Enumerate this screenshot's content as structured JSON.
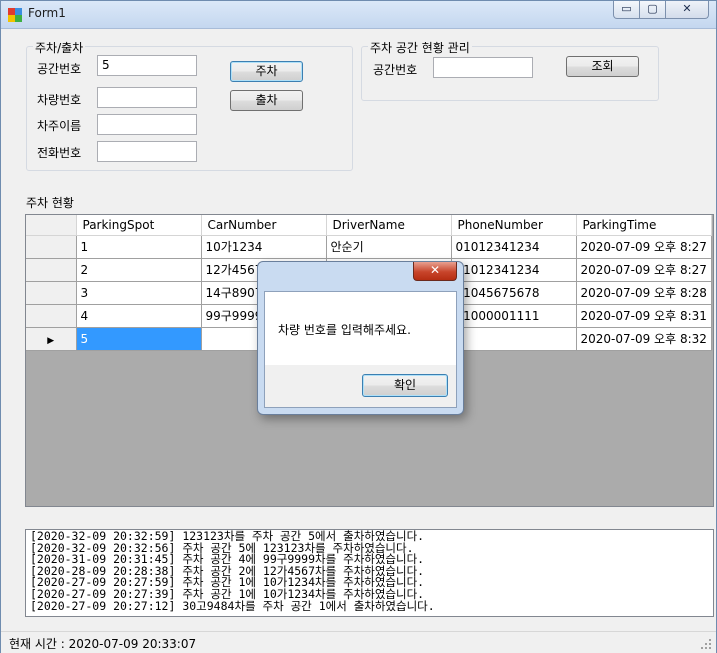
{
  "window": {
    "title": "Form1",
    "min_glyph": "▭",
    "max_glyph": "▢",
    "close_glyph": "✕"
  },
  "parking_group": {
    "title": "주차/출차",
    "labels": {
      "spot": "공간번호",
      "car": "차량번호",
      "driver": "차주이름",
      "phone": "전화번호"
    },
    "values": {
      "spot": "5",
      "car": "",
      "driver": "",
      "phone": ""
    },
    "park_button": "주차",
    "exit_button": "출차"
  },
  "status_group": {
    "title": "주차 공간 현황 관리",
    "spot_label": "공간번호",
    "spot_value": "",
    "query_button": "조회"
  },
  "grid": {
    "title": "주차 현황",
    "columns": [
      "ParkingSpot",
      "CarNumber",
      "DriverName",
      "PhoneNumber",
      "ParkingTime"
    ],
    "rows": [
      [
        "1",
        "10가1234",
        "안순기",
        "01012341234",
        "2020-07-09 오후 8:27"
      ],
      [
        "2",
        "12가4567",
        "",
        "01012341234",
        "2020-07-09 오후 8:27"
      ],
      [
        "3",
        "14구8907",
        "",
        "01045675678",
        "2020-07-09 오후 8:28"
      ],
      [
        "4",
        "99구9999",
        "",
        "01000001111",
        "2020-07-09 오후 8:31"
      ],
      [
        "5",
        "",
        "",
        "",
        "2020-07-09 오후 8:32"
      ]
    ],
    "current_row_marker": "▶"
  },
  "log": {
    "lines": [
      "[2020-32-09 20:32:59] 123123차를 주차 공간 5에서 출차하였습니다.",
      "[2020-32-09 20:32:56] 주차 공간 5에 123123차를 주차하였습니다.",
      "[2020-31-09 20:31:45] 주차 공간 4에 99구9999차를 주차하였습니다.",
      "[2020-28-09 20:28:38] 주차 공간 2에 12가4567차를 주차하였습니다.",
      "[2020-27-09 20:27:59] 주차 공간 1에 10가1234차를 주차하였습니다.",
      "[2020-27-09 20:27:39] 주차 공간 1에 10가1234차를 주차하였습니다.",
      "[2020-27-09 20:27:12] 30고9484차를 주차 공간 1에서 출차하였습니다."
    ]
  },
  "statusbar": {
    "text": "현재 시간 : 2020-07-09 20:33:07"
  },
  "dialog": {
    "close_glyph": "✕",
    "message": "차량 번호를 입력해주세요.",
    "ok_button": "확인"
  },
  "colors": {
    "selection": "#3399ff",
    "grid_background": "#ababab",
    "dialog_close": "#c8452b"
  }
}
